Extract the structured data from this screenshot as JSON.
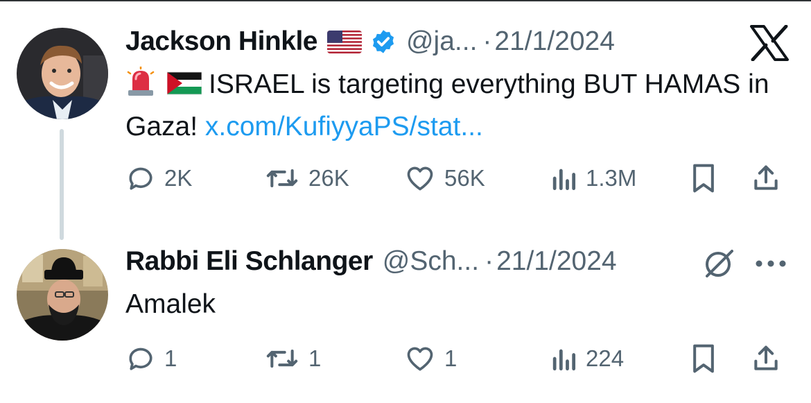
{
  "tweets": [
    {
      "author_name": "Jackson Hinkle",
      "flag_emoji": "us-flag",
      "verified": true,
      "handle": "@ja...",
      "separator": "·",
      "date": "21/1/2024",
      "text_emoji": [
        "police-light-emoji",
        "palestine-flag-emoji"
      ],
      "text_main": "ISRAEL is targeting everything BUT HAMAS in Gaza!",
      "link": "x.com/KufiyyaPS/stat...",
      "stats": {
        "replies": "2K",
        "retweets": "26K",
        "likes": "56K",
        "views": "1.3M"
      },
      "corner_icon": "x-logo-icon"
    },
    {
      "author_name": "Rabbi Eli Schlanger",
      "handle": "@Sch...",
      "separator": "·",
      "date": "21/1/2024",
      "text_main": "Amalek",
      "stats": {
        "replies": "1",
        "retweets": "1",
        "likes": "1",
        "views": "224"
      },
      "corner_icons": [
        "grok-icon",
        "more-icon"
      ]
    }
  ],
  "colors": {
    "text": "#0f1419",
    "secondary": "#536471",
    "link": "#1d9bf0",
    "verified": "#1d9bf0",
    "thread_line": "#cfd9de"
  }
}
